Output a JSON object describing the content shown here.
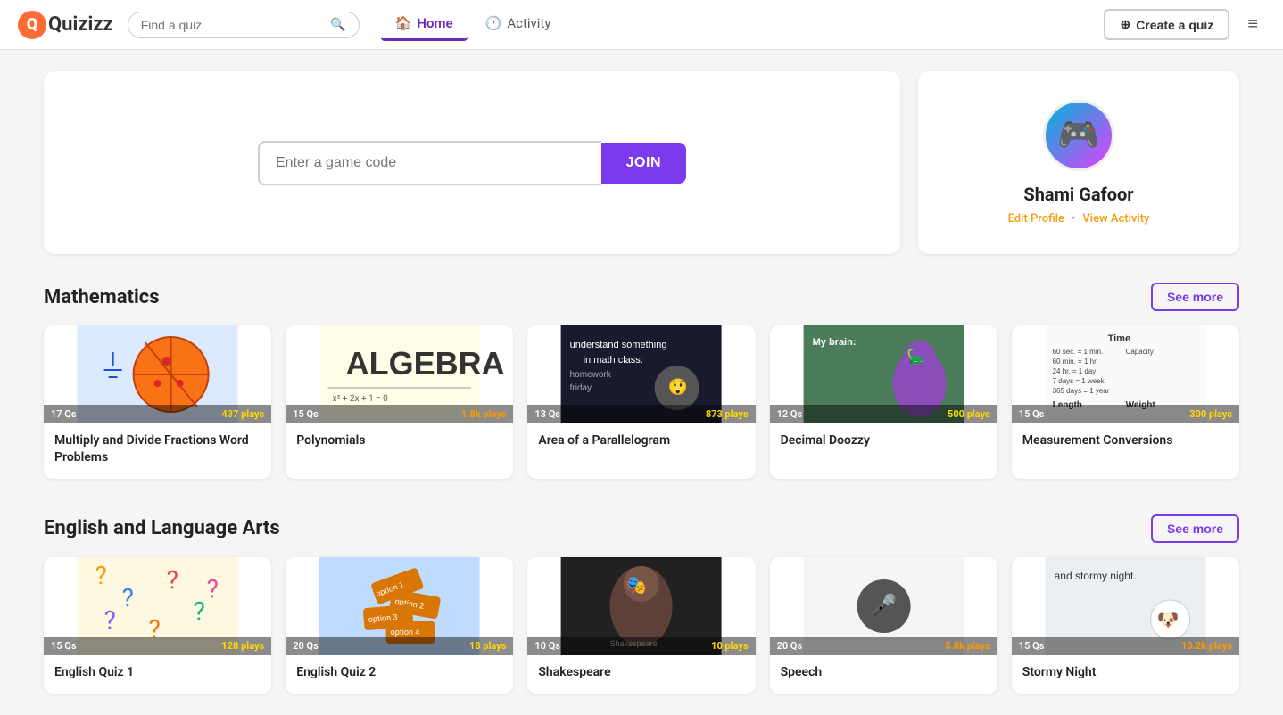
{
  "nav": {
    "logo_text": "Quizizz",
    "search_placeholder": "Find a quiz",
    "home_label": "Home",
    "activity_label": "Activity",
    "create_label": "Create a quiz"
  },
  "join": {
    "placeholder": "Enter a game code",
    "button_label": "JOIN"
  },
  "profile": {
    "name": "Shami Gafoor",
    "edit_label": "Edit Profile",
    "view_label": "View Activity",
    "dot": "•"
  },
  "math_section": {
    "title": "Mathematics",
    "see_more": "See more",
    "quizzes": [
      {
        "title": "Multiply and Divide Fractions Word Problems",
        "questions": "17 Qs",
        "plays": "437 plays",
        "plays_color": "normal",
        "bg": "#e8f4fd",
        "emoji": "🍕"
      },
      {
        "title": "Polynomials",
        "questions": "15 Qs",
        "plays": "1.8k plays",
        "plays_color": "orange",
        "bg": "#fffde7",
        "emoji": "📐"
      },
      {
        "title": "Area of a Parallelogram",
        "questions": "13 Qs",
        "plays": "873 plays",
        "plays_color": "normal",
        "bg": "#1a1a2e",
        "emoji": "📊"
      },
      {
        "title": "Decimal Doozzy",
        "questions": "12 Qs",
        "plays": "500 plays",
        "plays_color": "normal",
        "bg": "#e8f5e9",
        "emoji": "🦕"
      },
      {
        "title": "Measurement Conversions",
        "questions": "15 Qs",
        "plays": "300 plays",
        "plays_color": "normal",
        "bg": "#f9f9f9",
        "emoji": "📏"
      }
    ]
  },
  "english_section": {
    "title": "English and Language Arts",
    "see_more": "See more",
    "quizzes": [
      {
        "title": "English Quiz 1",
        "questions": "15 Qs",
        "plays": "128 plays",
        "plays_color": "normal",
        "bg": "#fff8e1",
        "emoji": "❓"
      },
      {
        "title": "English Quiz 2",
        "questions": "20 Qs",
        "plays": "18 plays",
        "plays_color": "normal",
        "bg": "#e3f2fd",
        "emoji": "🔀"
      },
      {
        "title": "Shakespeare",
        "questions": "10 Qs",
        "plays": "10 plays",
        "plays_color": "normal",
        "bg": "#212121",
        "emoji": "🎭"
      },
      {
        "title": "Speech",
        "questions": "20 Qs",
        "plays": "5.0k plays",
        "plays_color": "orange",
        "bg": "#f5f5f5",
        "emoji": "🎤"
      },
      {
        "title": "Stormy Night",
        "questions": "15 Qs",
        "plays": "10.2k plays",
        "plays_color": "orange",
        "bg": "#eceff1",
        "emoji": "🌩️"
      }
    ]
  }
}
